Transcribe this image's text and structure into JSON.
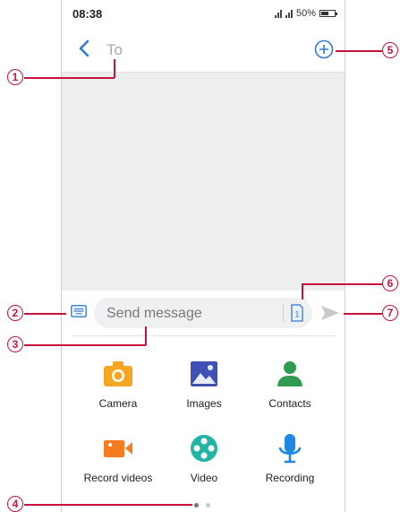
{
  "status": {
    "time": "08:38",
    "battery": "50%"
  },
  "header": {
    "to_placeholder": "To"
  },
  "composer": {
    "placeholder": "Send message",
    "sim_label": "1"
  },
  "attachments": [
    {
      "label": "Camera",
      "icon": "camera-icon",
      "color": "#f5a623"
    },
    {
      "label": "Images",
      "icon": "images-icon",
      "color": "#3f51b5"
    },
    {
      "label": "Contacts",
      "icon": "contacts-icon",
      "color": "#2e9b4f"
    },
    {
      "label": "Record videos",
      "icon": "record-video-icon",
      "color": "#f57c1f"
    },
    {
      "label": "Video",
      "icon": "video-reel-icon",
      "color": "#22b5a6"
    },
    {
      "label": "Recording",
      "icon": "microphone-icon",
      "color": "#1e88e5"
    }
  ],
  "callouts": [
    "1",
    "2",
    "3",
    "4",
    "5",
    "6",
    "7"
  ],
  "colors": {
    "accent": "#2f7bd1",
    "callout": "#c8123c"
  }
}
